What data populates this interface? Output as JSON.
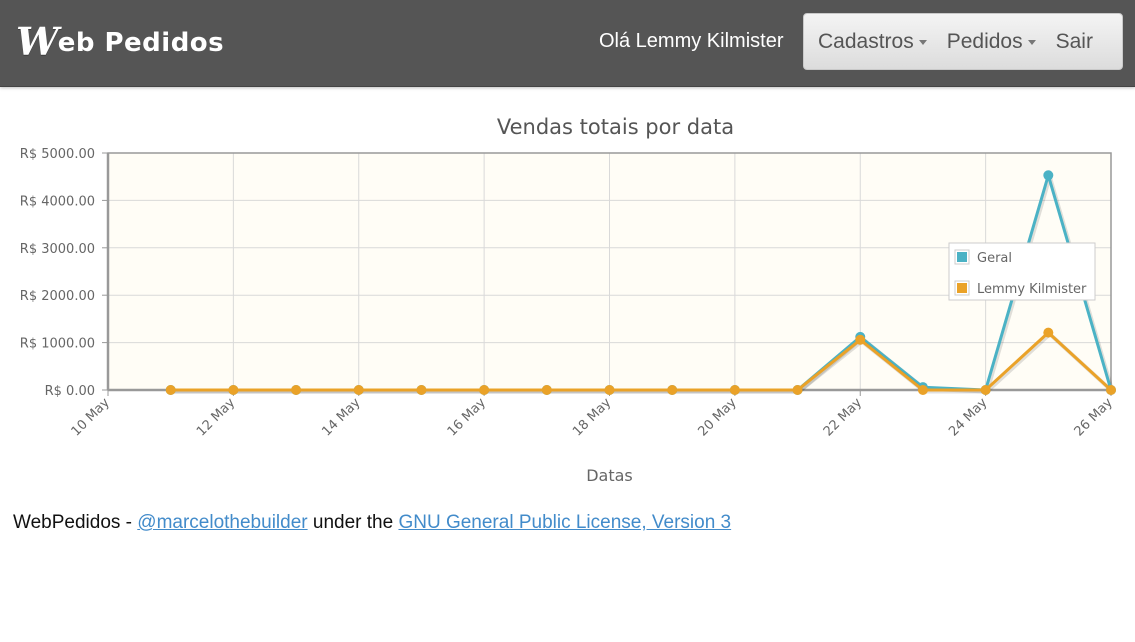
{
  "header": {
    "brand_w": "W",
    "brand_rest": "eb Pedidos",
    "greeting": "Olá Lemmy Kilmister",
    "menu": [
      {
        "label": "Cadastros",
        "dropdown": true
      },
      {
        "label": "Pedidos",
        "dropdown": true
      },
      {
        "label": "Sair",
        "dropdown": false
      }
    ]
  },
  "chart_data": {
    "type": "line",
    "title": "Vendas totais por data",
    "xlabel": "Datas",
    "ylabel": "",
    "ylim": [
      0,
      5000
    ],
    "y_ticks": [
      "R$ 0.00",
      "R$ 1000.00",
      "R$ 2000.00",
      "R$ 3000.00",
      "R$ 4000.00",
      "R$ 5000.00"
    ],
    "x_ticks": [
      "10 May",
      "12 May",
      "14 May",
      "16 May",
      "18 May",
      "20 May",
      "22 May",
      "24 May",
      "26 May"
    ],
    "x": [
      "10 May",
      "11 May",
      "12 May",
      "13 May",
      "14 May",
      "15 May",
      "16 May",
      "17 May",
      "18 May",
      "19 May",
      "20 May",
      "21 May",
      "22 May",
      "23 May",
      "24 May",
      "25 May",
      "26 May"
    ],
    "grid": true,
    "legend_position": "right",
    "plot_background": "#fffdf6",
    "series": [
      {
        "name": "Geral",
        "color": "#4bb2c5",
        "values": [
          null,
          0,
          0,
          0,
          0,
          0,
          0,
          0,
          0,
          0,
          0,
          0,
          1120,
          60,
          0,
          4530,
          0
        ]
      },
      {
        "name": "Lemmy Kilmister",
        "color": "#eaa228",
        "values": [
          null,
          0,
          0,
          0,
          0,
          0,
          0,
          0,
          0,
          0,
          0,
          0,
          1060,
          0,
          0,
          1210,
          0
        ]
      }
    ]
  },
  "footer": {
    "prefix": "WebPedidos - ",
    "author_link": "@marcelothebuilder",
    "middle": " under the ",
    "license_link": "GNU General Public License, Version 3"
  }
}
